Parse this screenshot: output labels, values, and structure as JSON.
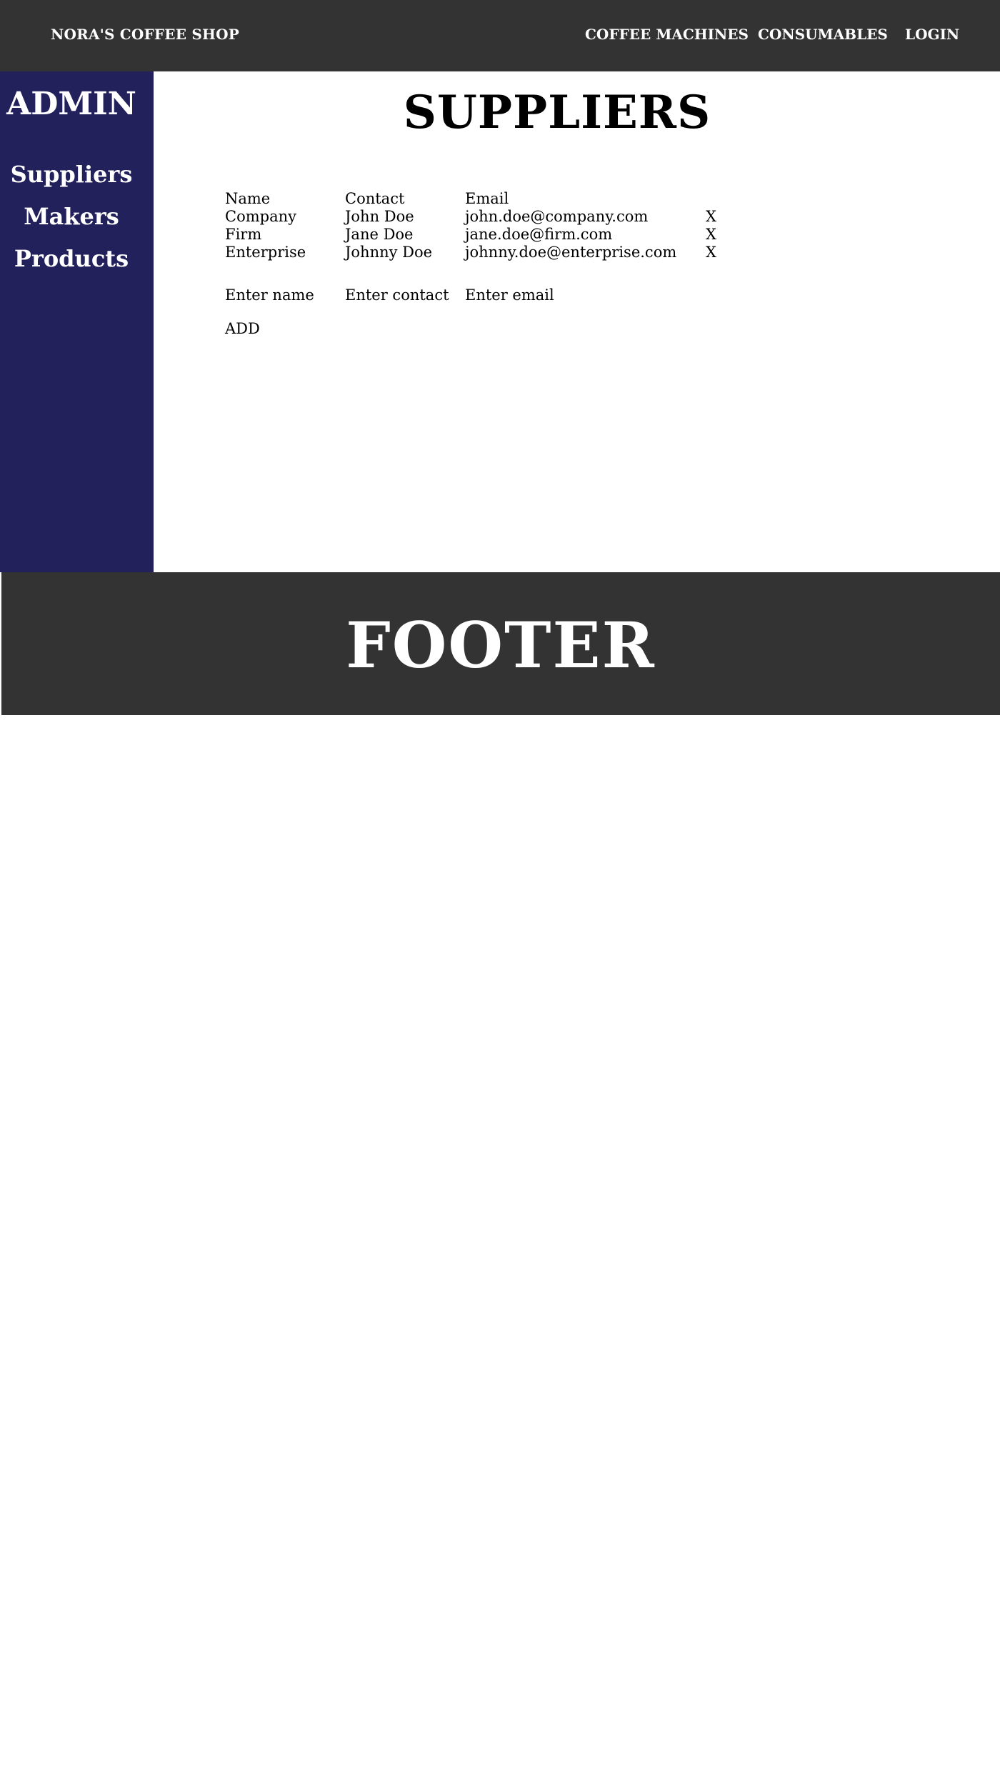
{
  "header": {
    "brand": "NORA'S COFFEE SHOP",
    "nav": [
      "COFFEE MACHINES",
      "CONSUMABLES",
      "LOGIN"
    ]
  },
  "sidebar": {
    "title": "ADMIN",
    "items": [
      "Suppliers",
      "Makers",
      "Products"
    ]
  },
  "main": {
    "title": "SUPPLIERS",
    "table": {
      "headers": [
        "Name",
        "Contact",
        "Email"
      ],
      "rows": [
        {
          "name": "Company",
          "contact": "John Doe",
          "email": "john.doe@company.com",
          "delete": "X"
        },
        {
          "name": "Firm",
          "contact": "Jane Doe",
          "email": "jane.doe@firm.com",
          "delete": "X"
        },
        {
          "name": "Enterprise",
          "contact": "Johnny Doe",
          "email": "johnny.doe@enterprise.com",
          "delete": "X"
        }
      ]
    },
    "form": {
      "name_placeholder": "Enter name",
      "contact_placeholder": "Enter contact",
      "email_placeholder": "Enter email",
      "add_label": "ADD"
    }
  },
  "footer": {
    "text": "FOOTER"
  },
  "colors": {
    "header_bg": "#333333",
    "sidebar_bg": "#23215c",
    "footer_bg": "#333333",
    "text_light": "#ffffff",
    "text_dark": "#000000"
  }
}
